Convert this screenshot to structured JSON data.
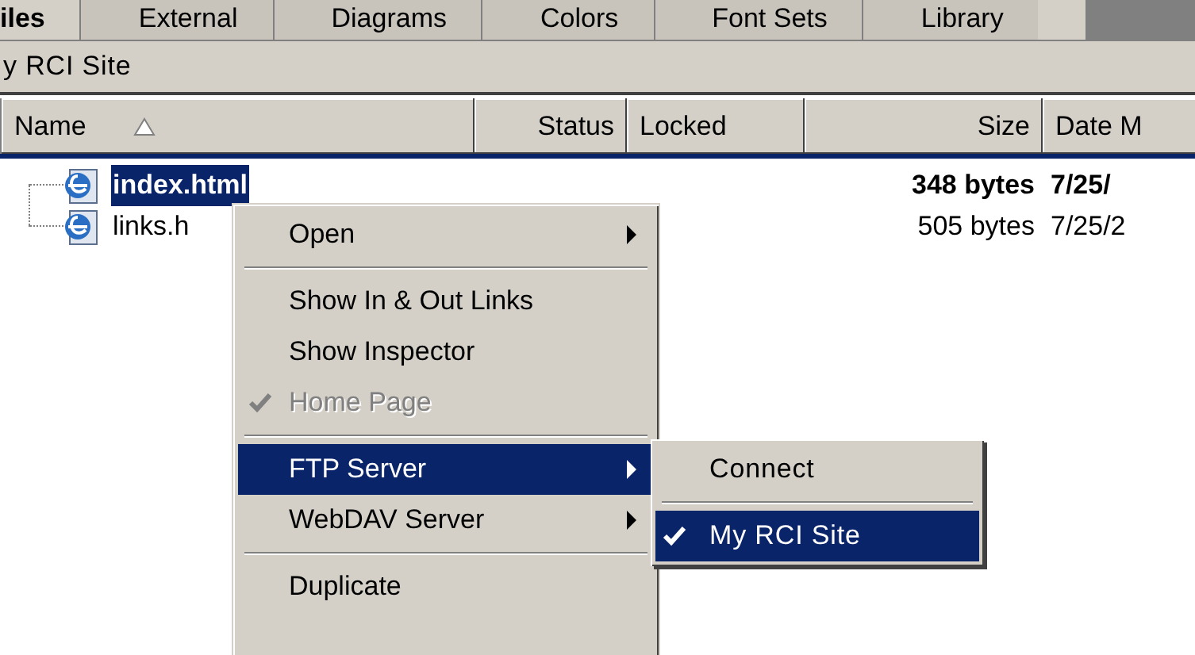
{
  "tabs": [
    {
      "label": "iles",
      "selected": true
    },
    {
      "label": "External",
      "selected": false
    },
    {
      "label": "Diagrams",
      "selected": false
    },
    {
      "label": "Colors",
      "selected": false
    },
    {
      "label": "Font Sets",
      "selected": false
    },
    {
      "label": "Library",
      "selected": false
    }
  ],
  "path": "y RCI Site",
  "table": {
    "columns": [
      {
        "label": "Name",
        "sorted": true
      },
      {
        "label": "Status",
        "sorted": false
      },
      {
        "label": "Locked",
        "sorted": false
      },
      {
        "label": "Size",
        "sorted": false
      },
      {
        "label": "Date M",
        "sorted": false
      }
    ],
    "rows": [
      {
        "name": "index.html",
        "selected": true,
        "home_page": true,
        "size": "348 bytes",
        "date": "7/25/"
      },
      {
        "name": "links.h",
        "selected": false,
        "home_page": false,
        "size": "505 bytes",
        "date": "7/25/2"
      }
    ]
  },
  "context_menu": [
    {
      "kind": "item",
      "label": "Open",
      "submenu": true,
      "disabled": false,
      "checked": false,
      "selected": false
    },
    {
      "kind": "separator"
    },
    {
      "kind": "item",
      "label": "Show In & Out Links",
      "submenu": false,
      "disabled": false,
      "checked": false,
      "selected": false
    },
    {
      "kind": "item",
      "label": "Show Inspector",
      "submenu": false,
      "disabled": false,
      "checked": false,
      "selected": false
    },
    {
      "kind": "item",
      "label": "Home Page",
      "submenu": false,
      "disabled": true,
      "checked": true,
      "selected": false
    },
    {
      "kind": "separator"
    },
    {
      "kind": "item",
      "label": "FTP Server",
      "submenu": true,
      "disabled": false,
      "checked": false,
      "selected": true
    },
    {
      "kind": "item",
      "label": "WebDAV Server",
      "submenu": true,
      "disabled": false,
      "checked": false,
      "selected": false
    },
    {
      "kind": "separator"
    },
    {
      "kind": "item",
      "label": "Duplicate",
      "submenu": false,
      "disabled": false,
      "checked": false,
      "selected": false
    }
  ],
  "submenu": [
    {
      "kind": "item",
      "label": "Connect",
      "checked": false,
      "selected": false
    },
    {
      "kind": "separator"
    },
    {
      "kind": "item",
      "label": "My RCI Site",
      "checked": true,
      "selected": true
    }
  ]
}
